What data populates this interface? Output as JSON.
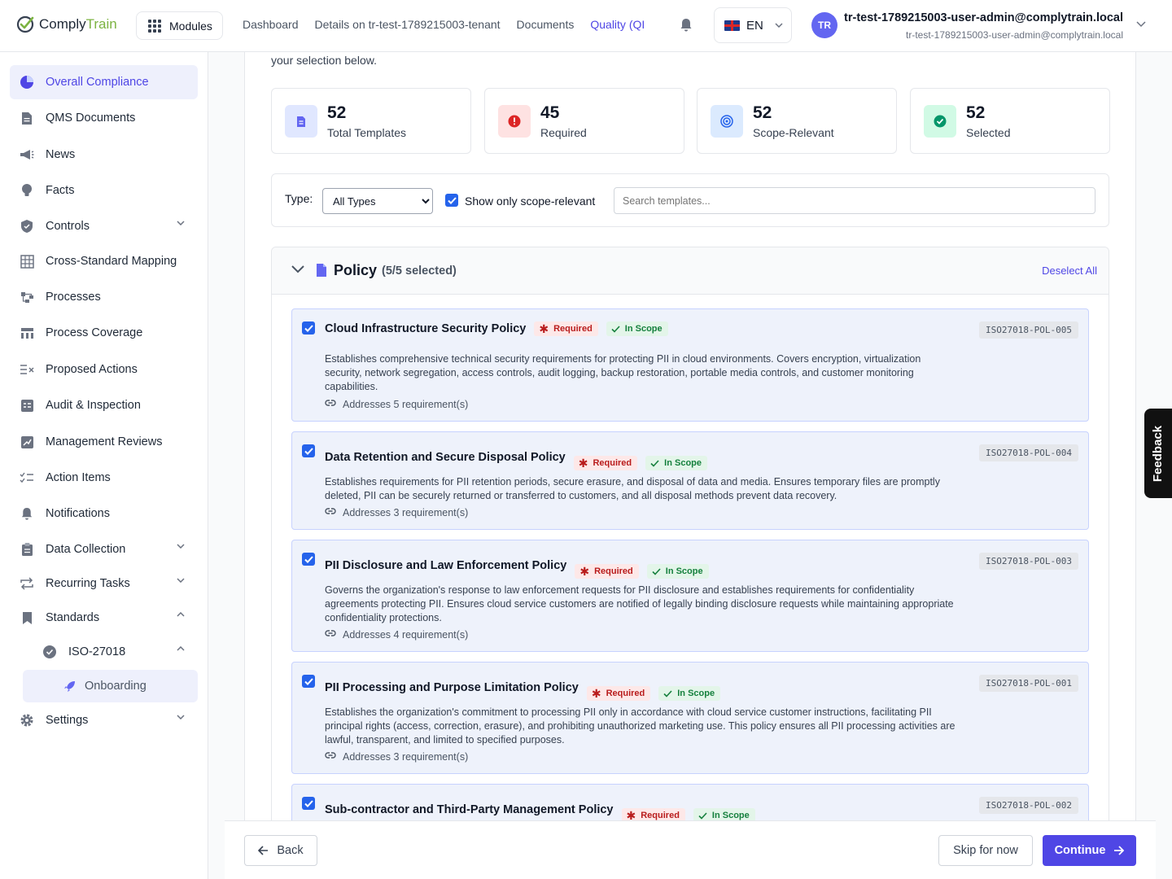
{
  "app": {
    "logo_part1": "Comply",
    "logo_part2": "Train",
    "modules_label": "Modules"
  },
  "topnav": {
    "items": [
      {
        "label": "Dashboard"
      },
      {
        "label": "Details on tr-test-1789215003-tenant"
      },
      {
        "label": "Documents"
      },
      {
        "label": "Quality (QI"
      }
    ]
  },
  "language": {
    "code": "EN"
  },
  "user": {
    "initials": "TR",
    "name": "tr-test-1789215003-user-admin@complytrain.local",
    "email": "tr-test-1789215003-user-admin@complytrain.local"
  },
  "sidebar": {
    "items": [
      {
        "label": "Overall Compliance",
        "icon": "pie-chart-icon"
      },
      {
        "label": "QMS Documents",
        "icon": "document-icon"
      },
      {
        "label": "News",
        "icon": "megaphone-icon"
      },
      {
        "label": "Facts",
        "icon": "lightbulb-icon"
      },
      {
        "label": "Controls",
        "icon": "shield-icon"
      },
      {
        "label": "Cross-Standard Mapping",
        "icon": "table-icon"
      },
      {
        "label": "Processes",
        "icon": "flow-icon"
      },
      {
        "label": "Process Coverage",
        "icon": "coverage-icon"
      },
      {
        "label": "Proposed Actions",
        "icon": "list-x-icon"
      },
      {
        "label": "Audit & Inspection",
        "icon": "audit-icon"
      },
      {
        "label": "Management Reviews",
        "icon": "review-icon"
      },
      {
        "label": "Action Items",
        "icon": "checklist-icon"
      },
      {
        "label": "Notifications",
        "icon": "bell-icon"
      },
      {
        "label": "Data Collection",
        "icon": "clipboard-icon"
      },
      {
        "label": "Recurring Tasks",
        "icon": "repeat-icon"
      },
      {
        "label": "Standards",
        "icon": "bookmark-icon"
      },
      {
        "label": "ISO-27018",
        "icon": "badge-check-icon"
      },
      {
        "label": "Onboarding",
        "icon": "rocket-icon"
      },
      {
        "label": "Settings",
        "icon": "gear-icon"
      }
    ]
  },
  "main": {
    "intro_text": "your selection below.",
    "stats": [
      {
        "value": "52",
        "label": "Total Templates",
        "color": "#6366f1"
      },
      {
        "value": "45",
        "label": "Required",
        "color": "#dc2626"
      },
      {
        "value": "52",
        "label": "Scope-Relevant",
        "color": "#2563eb"
      },
      {
        "value": "52",
        "label": "Selected",
        "color": "#059669"
      }
    ],
    "filters": {
      "type_label": "Type:",
      "type_selected": "All Types",
      "scope_checkbox_label": "Show only scope-relevant",
      "scope_checked": true,
      "search_placeholder": "Search templates..."
    },
    "section": {
      "title": "Policy",
      "count": "(5/5 selected)",
      "deselect_label": "Deselect All"
    },
    "templates": [
      {
        "title": "Cloud Infrastructure Security Policy",
        "required": "Required",
        "scope": "In Scope",
        "code": "ISO27018-POL-005",
        "description": "Establishes comprehensive technical security requirements for protecting PII in cloud environments. Covers encryption, virtualization security, network segregation, access controls, audit logging, backup restoration, portable media controls, and customer monitoring capabilities.",
        "addresses": "Addresses 5 requirement(s)",
        "checked": true
      },
      {
        "title": "Data Retention and Secure Disposal Policy",
        "required": "Required",
        "scope": "In Scope",
        "code": "ISO27018-POL-004",
        "description": "Establishes requirements for PII retention periods, secure erasure, and disposal of data and media. Ensures temporary files are promptly deleted, PII can be securely returned or transferred to customers, and all disposal methods prevent data recovery.",
        "addresses": "Addresses 3 requirement(s)",
        "checked": true
      },
      {
        "title": "PII Disclosure and Law Enforcement Policy",
        "required": "Required",
        "scope": "In Scope",
        "code": "ISO27018-POL-003",
        "description": "Governs the organization's response to law enforcement requests for PII disclosure and establishes requirements for confidentiality agreements protecting PII. Ensures cloud service customers are notified of legally binding disclosure requests while maintaining appropriate confidentiality protections.",
        "addresses": "Addresses 4 requirement(s)",
        "checked": true
      },
      {
        "title": "PII Processing and Purpose Limitation Policy",
        "required": "Required",
        "scope": "In Scope",
        "code": "ISO27018-POL-001",
        "description": "Establishes the organization's commitment to processing PII only in accordance with cloud service customer instructions, facilitating PII principal rights (access, correction, erasure), and prohibiting unauthorized marketing use. This policy ensures all PII processing activities are lawful, transparent, and limited to specified purposes.",
        "addresses": "Addresses 3 requirement(s)",
        "checked": true
      },
      {
        "title": "Sub-contractor and Third-Party Management Policy",
        "required": "Required",
        "scope": "In Scope",
        "code": "ISO27018-POL-002",
        "description": "",
        "addresses": "",
        "checked": true
      }
    ]
  },
  "footer": {
    "back_label": "Back",
    "skip_label": "Skip for now",
    "continue_label": "Continue"
  },
  "feedback_label": "Feedback",
  "colors": {
    "accent": "#4f46e5",
    "required": "#b91c1c",
    "in_scope": "#15803d",
    "checkbox": "#2563eb"
  }
}
